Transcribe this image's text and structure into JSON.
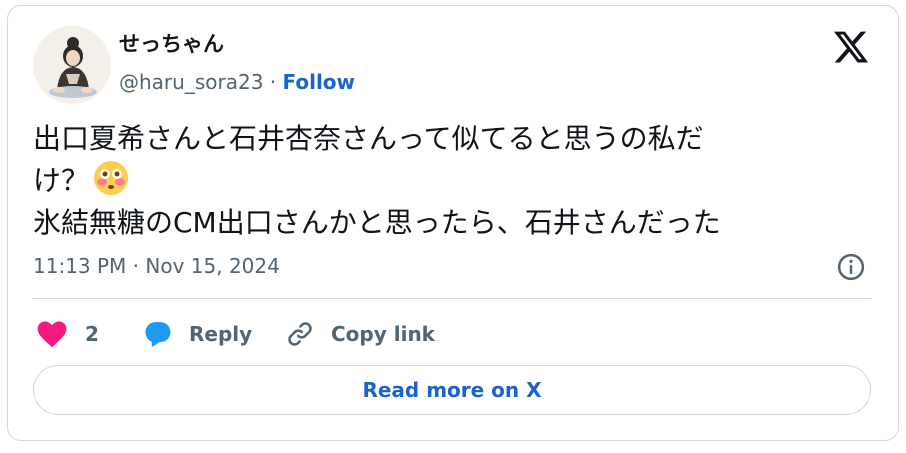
{
  "author": {
    "display_name": "せっちゃん",
    "handle": "@haru_sora23",
    "separator": "·",
    "follow_label": "Follow"
  },
  "tweet": {
    "line1": "出口夏希さんと石井杏奈さんって似てると思うの私だ",
    "line2": "け？",
    "line2_emoji": "flushed-face-emoji",
    "line3": "氷結無糖のCM出口さんかと思ったら、石井さんだった"
  },
  "timestamp": "11:13 PM · Nov 15, 2024",
  "actions": {
    "like_count": "2",
    "reply_label": "Reply",
    "copy_link_label": "Copy link"
  },
  "read_more_label": "Read more on X",
  "colors": {
    "text": "#0f1419",
    "secondary": "#536471",
    "link_blue": "#1d64c8",
    "like_pink": "#f91880",
    "reply_blue": "#1d9bf0",
    "border": "#cfd9de"
  }
}
